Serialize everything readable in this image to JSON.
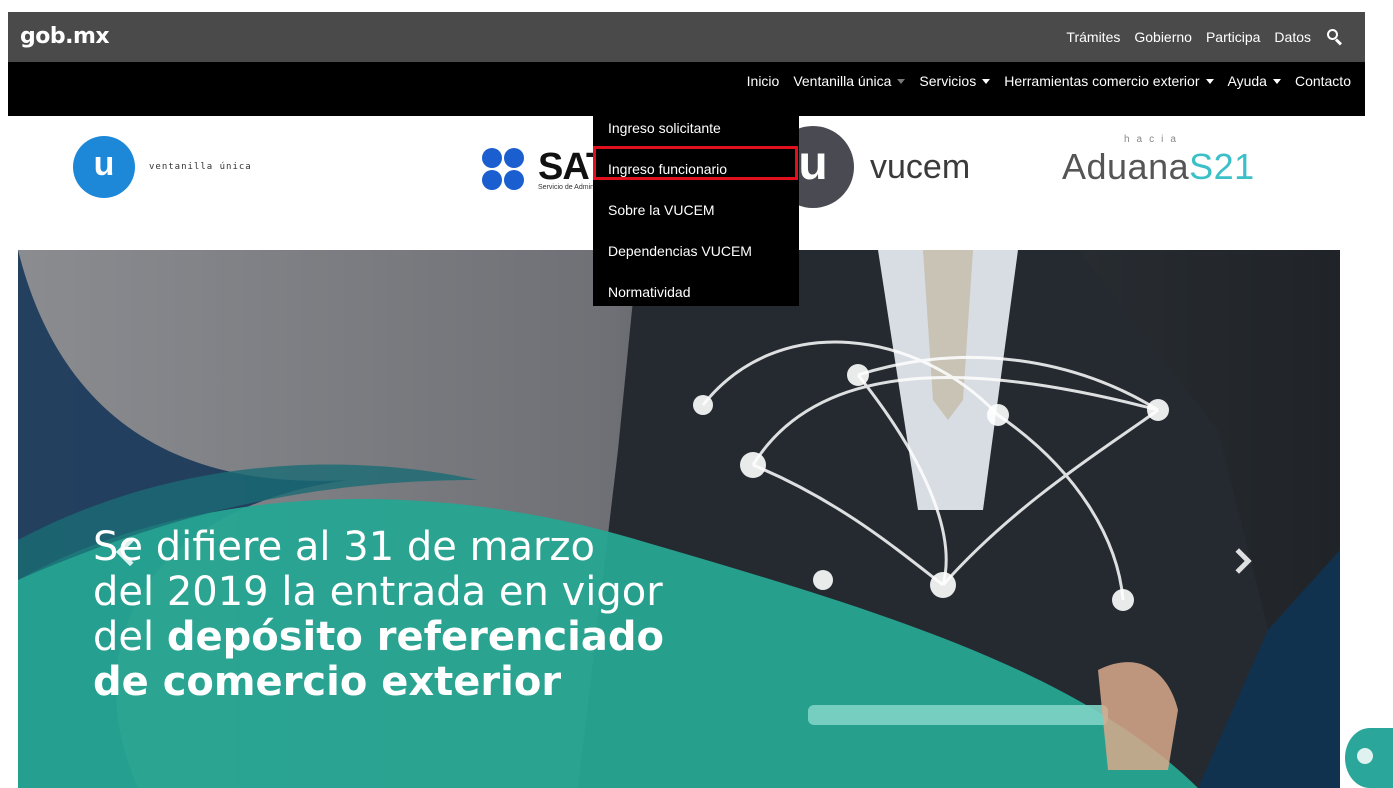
{
  "gob": {
    "logo": "gob.mx",
    "links": [
      "Trámites",
      "Gobierno",
      "Participa",
      "Datos"
    ]
  },
  "nav": {
    "items": [
      {
        "label": "Inicio"
      },
      {
        "label": "Ventanilla única"
      },
      {
        "label": "Servicios"
      },
      {
        "label": "Herramientas comercio exterior"
      },
      {
        "label": "Ayuda"
      },
      {
        "label": "Contacto"
      }
    ]
  },
  "dropdown": {
    "items": [
      "Ingreso solicitante",
      "Ingreso funcionario",
      "Sobre la VUCEM",
      "Dependencias VUCEM",
      "Normatividad"
    ]
  },
  "logos": {
    "vu_letter": "u",
    "vu_text": "ventanilla única",
    "sat_word": "SAT",
    "sat_sub": "Servicio de Administración Tributaria",
    "vucem_letter": "u",
    "vucem_word": "vucem",
    "aduana_hacia": "hacia",
    "aduana_main": "Aduana",
    "aduana_s21": "S21"
  },
  "hero": {
    "line1": "Se difiere al 31 de marzo",
    "line2": "del 2019 la entrada en vigor",
    "line3_prefix": "del ",
    "line3_bold": "depósito referenciado",
    "line4_bold": "de comercio exterior"
  },
  "colors": {
    "accent_teal": "#26a592",
    "highlight_red": "#e0111d",
    "vu_blue": "#1e88d8"
  }
}
